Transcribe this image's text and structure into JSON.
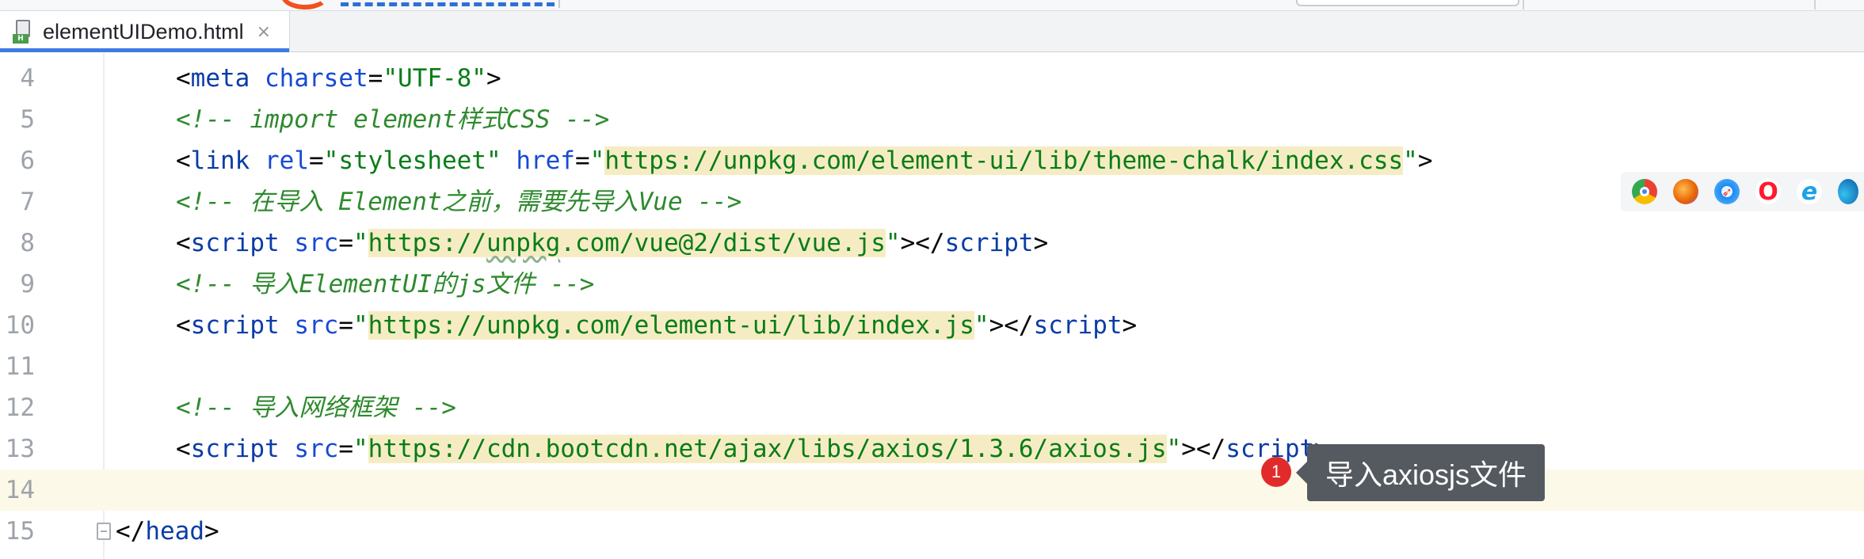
{
  "tab": {
    "title": "elementUIDemo.html",
    "close_glyph": "×",
    "file_icon": "html-file-icon",
    "file_badge": "H"
  },
  "editor": {
    "lines": [
      {
        "number": "4",
        "parts": [
          {
            "t": "<",
            "c": "punct"
          },
          {
            "t": "meta",
            "c": "tag"
          },
          {
            "t": " ",
            "c": "punct"
          },
          {
            "t": "charset",
            "c": "attr"
          },
          {
            "t": "=",
            "c": "punct"
          },
          {
            "t": "\"UTF-8\"",
            "c": "str"
          },
          {
            "t": ">",
            "c": "punct"
          }
        ]
      },
      {
        "number": "5",
        "parts": [
          {
            "t": "<!-- import element样式CSS -->",
            "c": "cmt"
          }
        ]
      },
      {
        "number": "6",
        "parts": [
          {
            "t": "<",
            "c": "punct"
          },
          {
            "t": "link",
            "c": "tag"
          },
          {
            "t": " ",
            "c": "punct"
          },
          {
            "t": "rel",
            "c": "attr"
          },
          {
            "t": "=",
            "c": "punct"
          },
          {
            "t": "\"stylesheet\"",
            "c": "str"
          },
          {
            "t": " ",
            "c": "punct"
          },
          {
            "t": "href",
            "c": "attr"
          },
          {
            "t": "=",
            "c": "punct"
          },
          {
            "t": "\"",
            "c": "str"
          },
          {
            "t": "https://unpkg.com/element-ui/lib/theme-chalk/index.css",
            "c": "url"
          },
          {
            "t": "\"",
            "c": "str"
          },
          {
            "t": ">",
            "c": "punct"
          }
        ]
      },
      {
        "number": "7",
        "parts": [
          {
            "t": "<!-- 在导入 Element之前，需要先导入Vue -->",
            "c": "cmt"
          }
        ]
      },
      {
        "number": "8",
        "parts": [
          {
            "t": "<",
            "c": "punct"
          },
          {
            "t": "script",
            "c": "tag"
          },
          {
            "t": " ",
            "c": "punct"
          },
          {
            "t": "src",
            "c": "attr"
          },
          {
            "t": "=",
            "c": "punct"
          },
          {
            "t": "\"",
            "c": "str"
          },
          {
            "t": "https://unpkg.com/vue@2/dist/vue.js",
            "c": "url"
          },
          {
            "t": "\"",
            "c": "str"
          },
          {
            "t": "></",
            "c": "punct"
          },
          {
            "t": "script",
            "c": "tag"
          },
          {
            "t": ">",
            "c": "punct"
          }
        ]
      },
      {
        "number": "9",
        "parts": [
          {
            "t": "<!-- 导入ElementUI的js文件 -->",
            "c": "cmt"
          }
        ]
      },
      {
        "number": "10",
        "parts": [
          {
            "t": "<",
            "c": "punct"
          },
          {
            "t": "script",
            "c": "tag"
          },
          {
            "t": " ",
            "c": "punct"
          },
          {
            "t": "src",
            "c": "attr"
          },
          {
            "t": "=",
            "c": "punct"
          },
          {
            "t": "\"",
            "c": "str"
          },
          {
            "t": "https://unpkg.com/element-ui/lib/index.js",
            "c": "url"
          },
          {
            "t": "\"",
            "c": "str"
          },
          {
            "t": "></",
            "c": "punct"
          },
          {
            "t": "script",
            "c": "tag"
          },
          {
            "t": ">",
            "c": "punct"
          }
        ]
      },
      {
        "number": "11",
        "parts": []
      },
      {
        "number": "12",
        "parts": [
          {
            "t": "<!-- 导入网络框架 -->",
            "c": "cmt"
          }
        ]
      },
      {
        "number": "13",
        "parts": [
          {
            "t": "<",
            "c": "punct"
          },
          {
            "t": "script",
            "c": "tag"
          },
          {
            "t": " ",
            "c": "punct"
          },
          {
            "t": "src",
            "c": "attr"
          },
          {
            "t": "=",
            "c": "punct"
          },
          {
            "t": "\"",
            "c": "str"
          },
          {
            "t": "https://cdn.bootcdn.net/ajax/libs/axios/1.3.6/axios.js",
            "c": "url"
          },
          {
            "t": "\"",
            "c": "str"
          },
          {
            "t": "></",
            "c": "punct"
          },
          {
            "t": "script",
            "c": "tag"
          },
          {
            "t": ">",
            "c": "punct"
          }
        ]
      },
      {
        "number": "14",
        "current": true,
        "parts": []
      },
      {
        "number": "15",
        "fold": true,
        "parts": [
          {
            "t": "</",
            "c": "punct"
          },
          {
            "t": "head",
            "c": "tag"
          },
          {
            "t": ">",
            "c": "punct"
          }
        ]
      }
    ]
  },
  "browsers": [
    {
      "name": "chrome-icon"
    },
    {
      "name": "firefox-icon"
    },
    {
      "name": "safari-icon"
    },
    {
      "name": "opera-icon",
      "glyph": "O"
    },
    {
      "name": "ie-icon",
      "glyph": "e"
    },
    {
      "name": "edge-icon"
    }
  ],
  "annotation": {
    "step_number": "1",
    "text": "导入axiosjs文件"
  },
  "colors": {
    "tag": "#0b3ca6",
    "attribute": "#174ad4",
    "string": "#077d17",
    "comment": "#2e8a2e",
    "url_highlight": "#f6ecc4",
    "current_line": "#fcf9e8",
    "tab_underline": "#3d7be3",
    "annotation_bg": "#555a60",
    "annotation_dot": "#e12b2b"
  }
}
